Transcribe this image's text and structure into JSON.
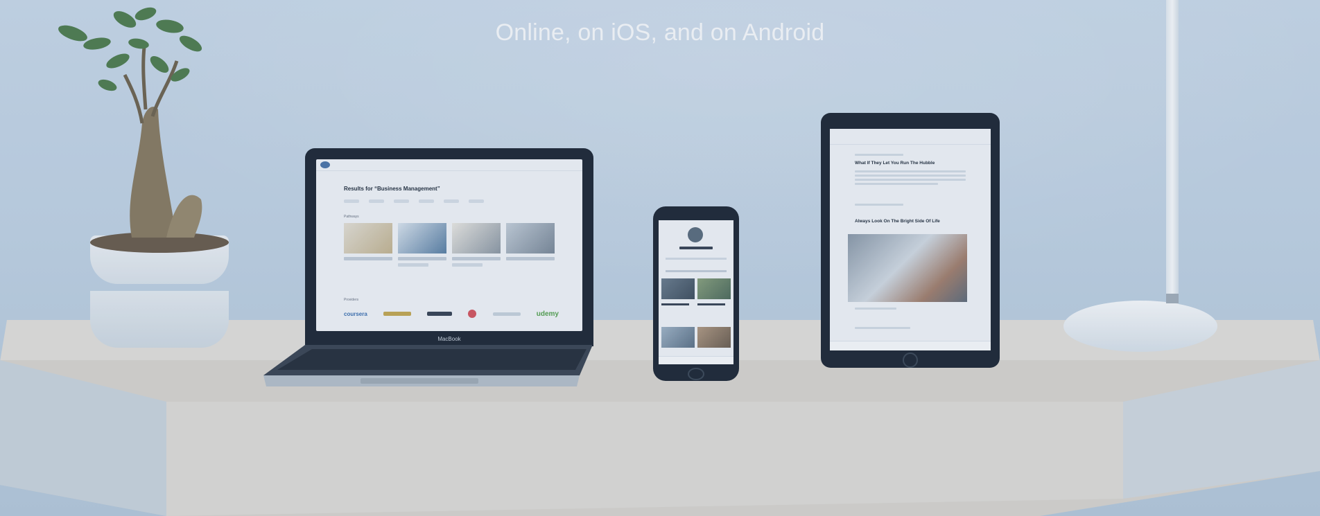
{
  "tagline": "Online, on iOS, and on Android",
  "devices": {
    "laptop": {
      "brand": "MacBook",
      "screen_title": "Results for “Business Management”",
      "section_pathways": "Pathways",
      "section_providers": "Providers",
      "provider_logos": [
        "coursera",
        "udemy"
      ]
    },
    "tablet": {
      "article_1_title": "What If They Let You Run The Hubble",
      "article_2_title": "Always Look On The Bright Side Of Life"
    }
  }
}
